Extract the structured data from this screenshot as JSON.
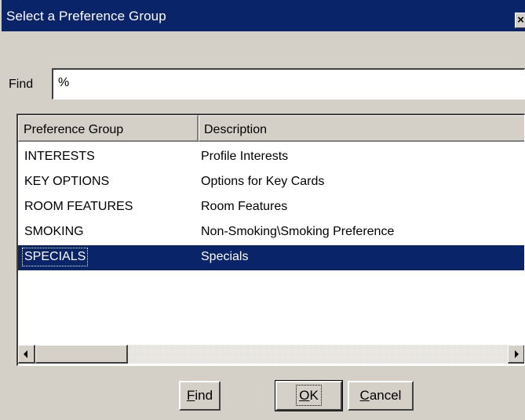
{
  "window": {
    "title": "Select a Preference Group",
    "close_glyph": "×"
  },
  "find_row": {
    "label": "Find",
    "value": "%"
  },
  "grid": {
    "columns": [
      "Preference Group",
      "Description"
    ],
    "rows": [
      {
        "group": "INTERESTS",
        "description": "Profile Interests"
      },
      {
        "group": "KEY OPTIONS",
        "description": "Options for Key Cards"
      },
      {
        "group": "ROOM FEATURES",
        "description": "Room Features"
      },
      {
        "group": "SMOKING",
        "description": "Non-Smoking\\Smoking Preference"
      },
      {
        "group": "SPECIALS",
        "description": "Specials"
      }
    ],
    "selected_row": "SPECIALS"
  },
  "buttons": {
    "find": {
      "mnemonic": "F",
      "rest": "ind"
    },
    "ok": {
      "mnemonic": "O",
      "rest": "K"
    },
    "cancel": {
      "mnemonic": "C",
      "rest": "ancel"
    }
  },
  "colors": {
    "title_bar": "#0a246a",
    "face": "#d4d0c8",
    "selection": "#0a246a"
  }
}
